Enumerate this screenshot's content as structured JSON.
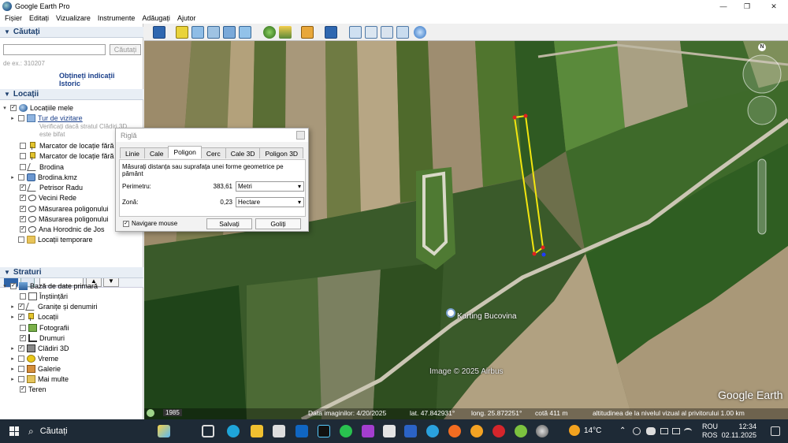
{
  "window": {
    "title": "Google Earth Pro",
    "minimize": "—",
    "maximize": "❐",
    "close": "✕"
  },
  "menu": [
    "Fișier",
    "Editați",
    "Vizualizare",
    "Instrumente",
    "Adăugați",
    "Ajutor"
  ],
  "search_section": {
    "header": "Căutați",
    "button": "Căutați",
    "hint": "de ex.: 310207",
    "links": [
      "Obțineți indicații",
      "Istoric"
    ]
  },
  "places_section": {
    "header": "Locații",
    "items": [
      {
        "label": "Locațiile mele",
        "checked": true,
        "icon": "globe-icon"
      },
      {
        "label": "Tur de vizitare",
        "checked": false,
        "icon": "folder-icon"
      },
      {
        "label": "Verificați dacă stratul Clădiri 3D",
        "grey": true
      },
      {
        "label": "este bifat",
        "grey": true
      },
      {
        "label": "Marcator de locație fără t",
        "checked": false,
        "icon": "pin-icon"
      },
      {
        "label": "Marcator de locație fără t",
        "checked": false,
        "icon": "pin-icon"
      },
      {
        "label": "Brodina",
        "checked": false,
        "icon": "path-icon"
      },
      {
        "label": "Brodina.kmz",
        "checked": false,
        "icon": "kmz-icon"
      },
      {
        "label": "Petrisor Radu",
        "checked": true,
        "icon": "path-icon"
      },
      {
        "label": "Vecini Rede",
        "checked": true,
        "icon": "polygon-icon"
      },
      {
        "label": "Măsurarea poligonului",
        "checked": true,
        "icon": "polygon-icon"
      },
      {
        "label": "Măsurarea poligonului",
        "checked": true,
        "icon": "polygon-icon"
      },
      {
        "label": "Ana Horodnic de Jos",
        "checked": true,
        "icon": "polygon-icon"
      },
      {
        "label": "Locații temporare",
        "checked": false,
        "icon": "folder-icon"
      }
    ]
  },
  "layers_section": {
    "header": "Straturi",
    "items": [
      {
        "label": "Bază de date primară",
        "checked": true,
        "icon": "layer-icon"
      },
      {
        "label": "Înștiințări",
        "checked": false,
        "icon": "doc-icon"
      },
      {
        "label": "Granițe și denumiri",
        "checked": true,
        "icon": "border-icon"
      },
      {
        "label": "Locații",
        "checked": true,
        "icon": "photo-icon"
      },
      {
        "label": "Fotografii",
        "checked": false,
        "icon": "photo-icon"
      },
      {
        "label": "Drumuri",
        "checked": true,
        "icon": "roads-icon"
      },
      {
        "label": "Clădiri 3D",
        "checked": true,
        "icon": "building-icon"
      },
      {
        "label": "Vreme",
        "checked": false,
        "icon": "sun-icon"
      },
      {
        "label": "Galerie",
        "checked": false,
        "icon": "gallery-icon"
      },
      {
        "label": "Mai multe",
        "checked": false,
        "icon": "more-icon"
      },
      {
        "label": "Teren",
        "checked": true,
        "icon": ""
      }
    ]
  },
  "ruler": {
    "title": "Riglă",
    "tabs": [
      "Linie",
      "Cale",
      "Poligon",
      "Cerc",
      "Cale 3D",
      "Poligon 3D"
    ],
    "active_tab": "Poligon",
    "description": "Măsurați distanța sau suprafața unei forme geometrice pe pământ",
    "perimeter_label": "Perimetru:",
    "perimeter_value": "383,61",
    "perimeter_unit": "Metri",
    "area_label": "Zonă:",
    "area_value": "0,23",
    "area_unit": "Hectare",
    "mouse_nav_label": "Navigare mouse",
    "mouse_nav_checked": true,
    "save_button": "Salvați",
    "clear_button": "Goliți"
  },
  "map": {
    "place_label": "Karting Bucovina",
    "attribution": "Image © 2025 Airbus",
    "logo": "Google Earth",
    "compass_letter": "N",
    "history_year": "1985",
    "status": {
      "imagery_date": "Data imaginilor: 4/20/2025",
      "lat": "lat.   47.842931°",
      "lon": "long.   25.872251°",
      "elev": "cotă   411 m",
      "eye_alt": "altitudinea de la nivelul vizual al privitorului   1.00 km"
    }
  },
  "taskbar": {
    "search": "Căutați",
    "weather": "14°C",
    "lang_top": "ROU",
    "lang_bottom": "ROS",
    "time": "12:34",
    "date": "02.11.2025"
  }
}
